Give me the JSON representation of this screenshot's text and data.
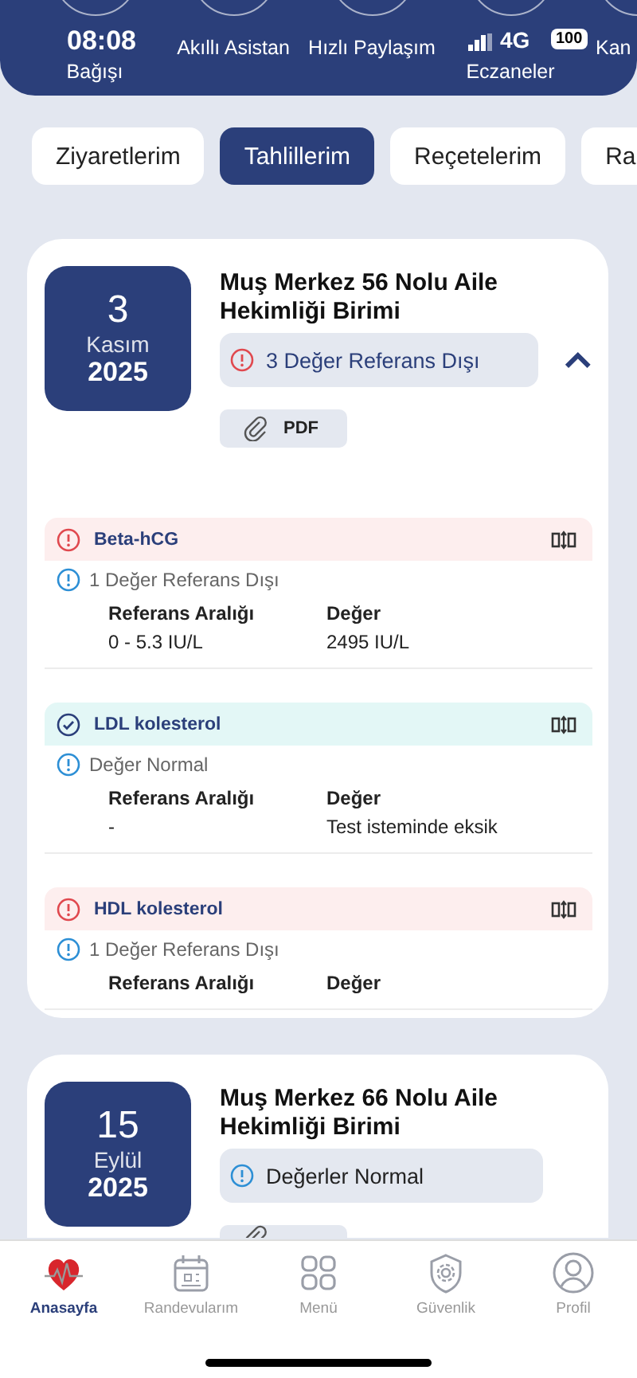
{
  "status_bar": {
    "time": "08:08",
    "network": "4G",
    "battery": "100"
  },
  "quick_actions": [
    {
      "label": "Bağışı",
      "kind": "covered"
    },
    {
      "label": "Akıllı Asistan",
      "kind": "plain"
    },
    {
      "label": "Hızlı Paylaşım",
      "kind": "plain"
    },
    {
      "label": "Eczaneler",
      "kind": "covered"
    },
    {
      "label": "Kan",
      "kind": "plain"
    }
  ],
  "tabs": [
    {
      "label": "Ziyaretlerim",
      "selected": false
    },
    {
      "label": "Tahlillerim",
      "selected": true
    },
    {
      "label": "Reçetelerim",
      "selected": false
    },
    {
      "label": "Ra",
      "selected": false
    }
  ],
  "visits": [
    {
      "day": "3",
      "month": "Kasım",
      "year": "2025",
      "facility": "Muş Merkez 56 Nolu Aile Hekimliği Birimi",
      "status": {
        "kind": "warning",
        "text": "3 Değer Referans Dışı"
      },
      "expanded": true,
      "attachment_label": "PDF",
      "results": [
        {
          "name": "Beta-hCG",
          "kind": "abnormal",
          "note": "1 Değer Referans Dışı",
          "columns": [
            "Referans Aralığı",
            "Değer"
          ],
          "values": [
            "0 - 5.3 IU/L",
            "2495 IU/L"
          ]
        },
        {
          "name": "LDL kolesterol",
          "kind": "normal",
          "note": "Değer Normal",
          "columns": [
            "Referans Aralığı",
            "Değer"
          ],
          "values": [
            "-",
            "Test isteminde eksik"
          ]
        },
        {
          "name": "HDL kolesterol",
          "kind": "abnormal",
          "note": "1 Değer Referans Dışı",
          "columns": [
            "Referans Aralığı",
            "Değer"
          ]
        }
      ]
    },
    {
      "day": "15",
      "month": "Eylül",
      "year": "2025",
      "facility": "Muş Merkez 66 Nolu Aile Hekimliği Birimi",
      "status": {
        "kind": "info",
        "text": "Değerler Normal"
      }
    }
  ],
  "bottom_nav": [
    {
      "label": "Anasayfa",
      "kind": "home",
      "selected": true
    },
    {
      "label": "Randevularım",
      "kind": "calendar",
      "selected": false
    },
    {
      "label": "Menü",
      "kind": "grid",
      "selected": false
    },
    {
      "label": "Güvenlik",
      "kind": "shield",
      "selected": false
    },
    {
      "label": "Profil",
      "kind": "profile",
      "selected": false
    }
  ]
}
